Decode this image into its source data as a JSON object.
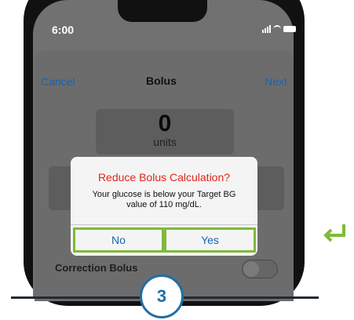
{
  "status_bar": {
    "time": "6:00"
  },
  "nav": {
    "cancel_label": "Cancel",
    "title": "Bolus",
    "next_label": "Next"
  },
  "bolus": {
    "units_value": "0",
    "units_label": "units"
  },
  "correction": {
    "label": "Correction Bolus",
    "enabled": false
  },
  "alert": {
    "title": "Reduce Bolus Calculation?",
    "message": "Your glucose is below your Target BG value of 110 mg/dL.",
    "no_label": "No",
    "yes_label": "Yes"
  },
  "step": {
    "number": "3"
  },
  "colors": {
    "accent_blue": "#1a63b0",
    "alert_red": "#e0251c",
    "highlight_green": "#7fba3a",
    "step_blue": "#1f6fa6"
  }
}
